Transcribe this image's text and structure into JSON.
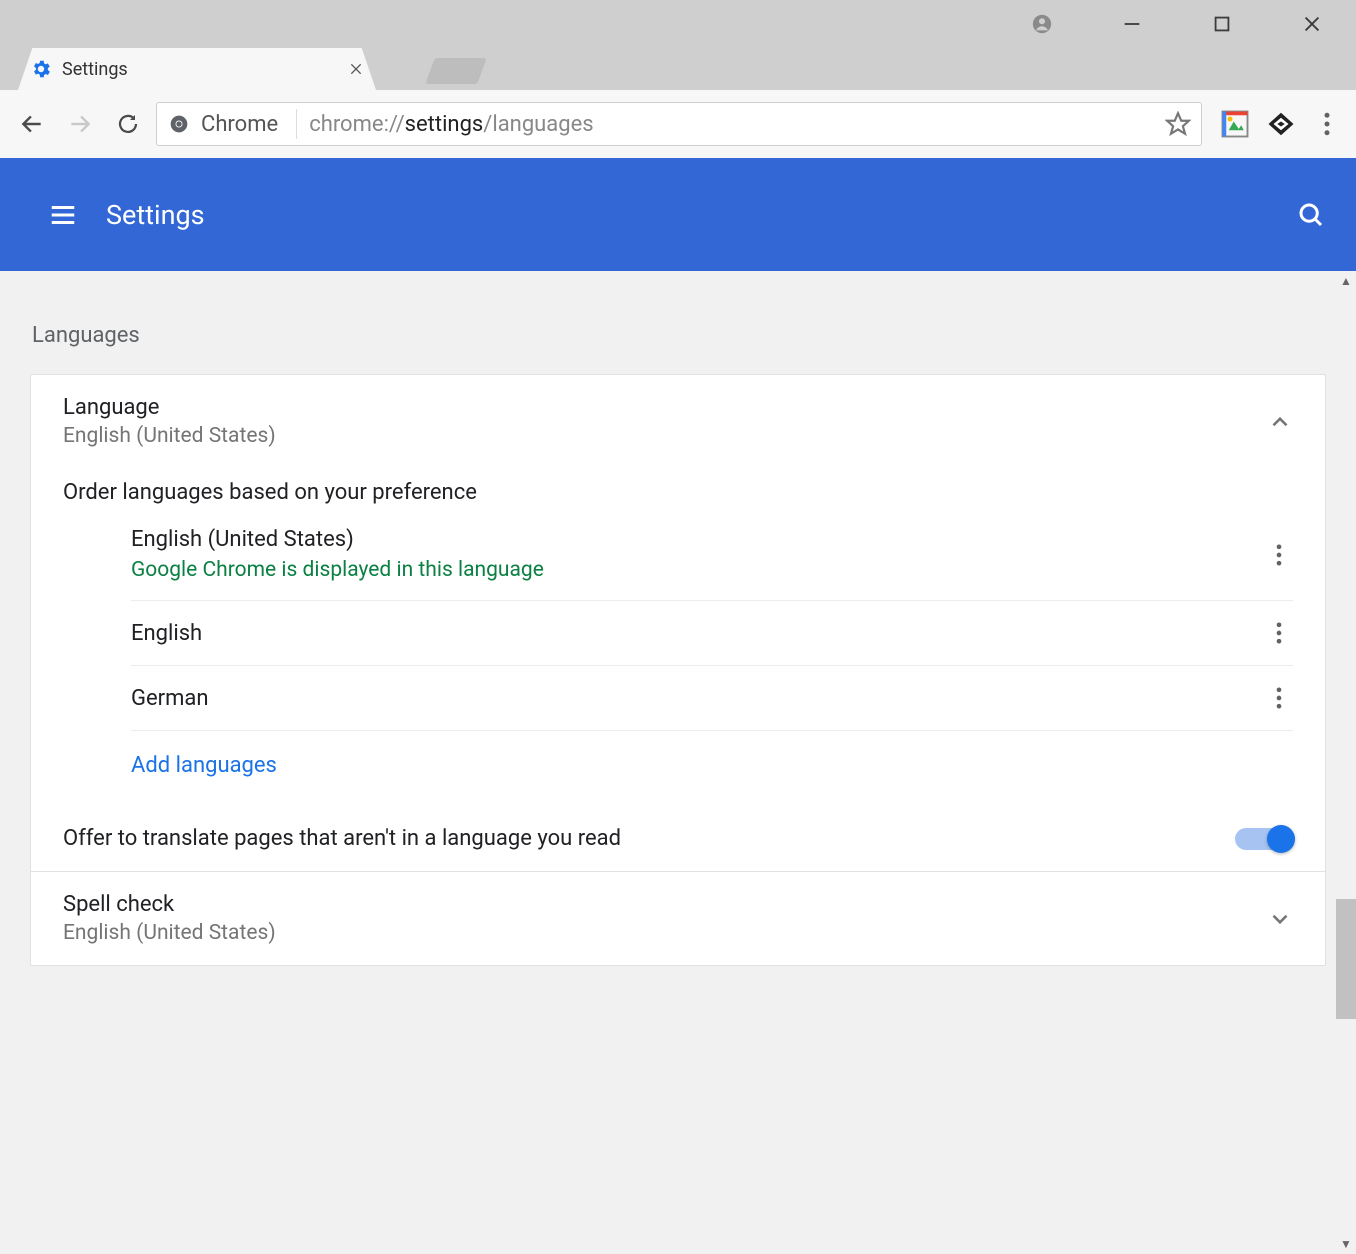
{
  "browser": {
    "tab_title": "Settings",
    "address_scheme": "chrome://",
    "address_path1": "settings",
    "address_path2": "/languages",
    "chrome_label": "Chrome"
  },
  "header": {
    "title": "Settings"
  },
  "section": {
    "title": "Languages"
  },
  "language_panel": {
    "title": "Language",
    "subtitle": "English (United States)",
    "helper": "Order languages based on your preference",
    "items": [
      {
        "name": "English (United States)",
        "note": "Google Chrome is displayed in this language"
      },
      {
        "name": "English",
        "note": ""
      },
      {
        "name": "German",
        "note": ""
      }
    ],
    "add_label": "Add languages"
  },
  "translate_row": {
    "label": "Offer to translate pages that aren't in a language you read",
    "on": true
  },
  "spell_panel": {
    "title": "Spell check",
    "subtitle": "English (United States)"
  }
}
